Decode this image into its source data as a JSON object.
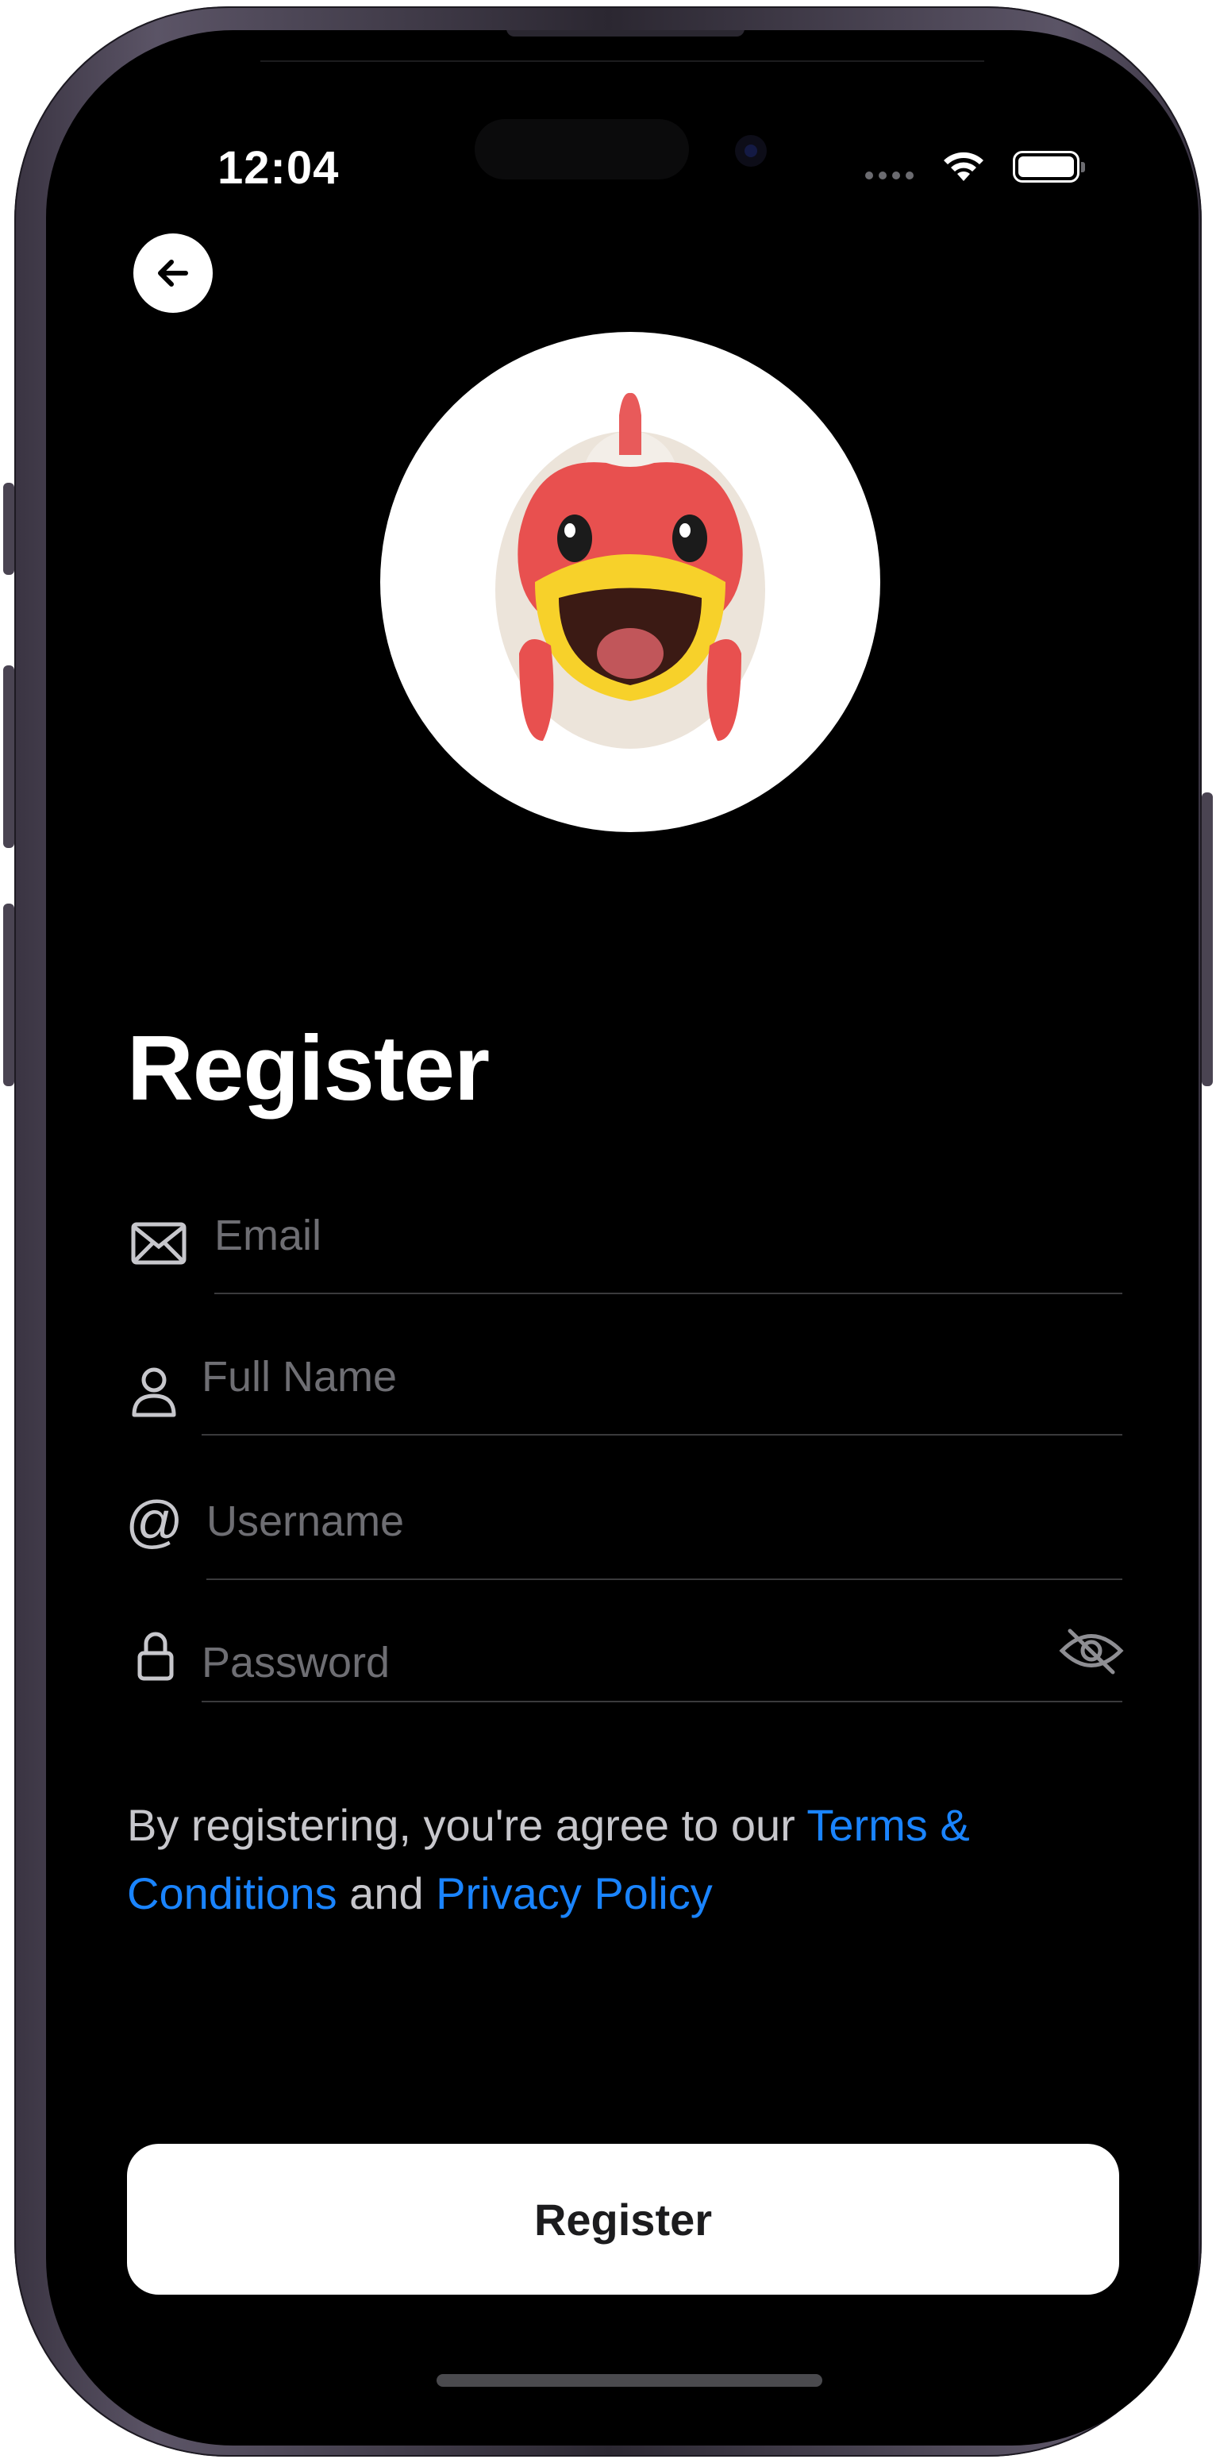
{
  "status_bar": {
    "time": "12:04",
    "icons": [
      "cellular-signal-icon",
      "wifi-icon",
      "battery-icon"
    ]
  },
  "nav": {
    "back_icon": "arrow-left-icon"
  },
  "avatar": {
    "description": "rooster-memoji-avatar"
  },
  "page": {
    "title": "Register"
  },
  "form": {
    "email": {
      "placeholder": "Email",
      "value": "",
      "icon": "envelope-icon"
    },
    "full_name": {
      "placeholder": "Full Name",
      "value": "",
      "icon": "person-icon"
    },
    "username": {
      "placeholder": "Username",
      "value": "",
      "icon": "at-sign-icon"
    },
    "password": {
      "placeholder": "Password",
      "value": "",
      "icon": "lock-icon",
      "toggle_icon": "eye-slash-icon"
    }
  },
  "terms": {
    "prefix": "By registering, you're agree to our ",
    "terms_link": "Terms & Conditions",
    "middle": " and ",
    "privacy_link": "Privacy Policy"
  },
  "actions": {
    "register_label": "Register"
  },
  "colors": {
    "background": "#000000",
    "link": "#1a84ff",
    "button": "#ffffff",
    "placeholder": "#6e6e73",
    "divider": "#3a3a3c"
  }
}
